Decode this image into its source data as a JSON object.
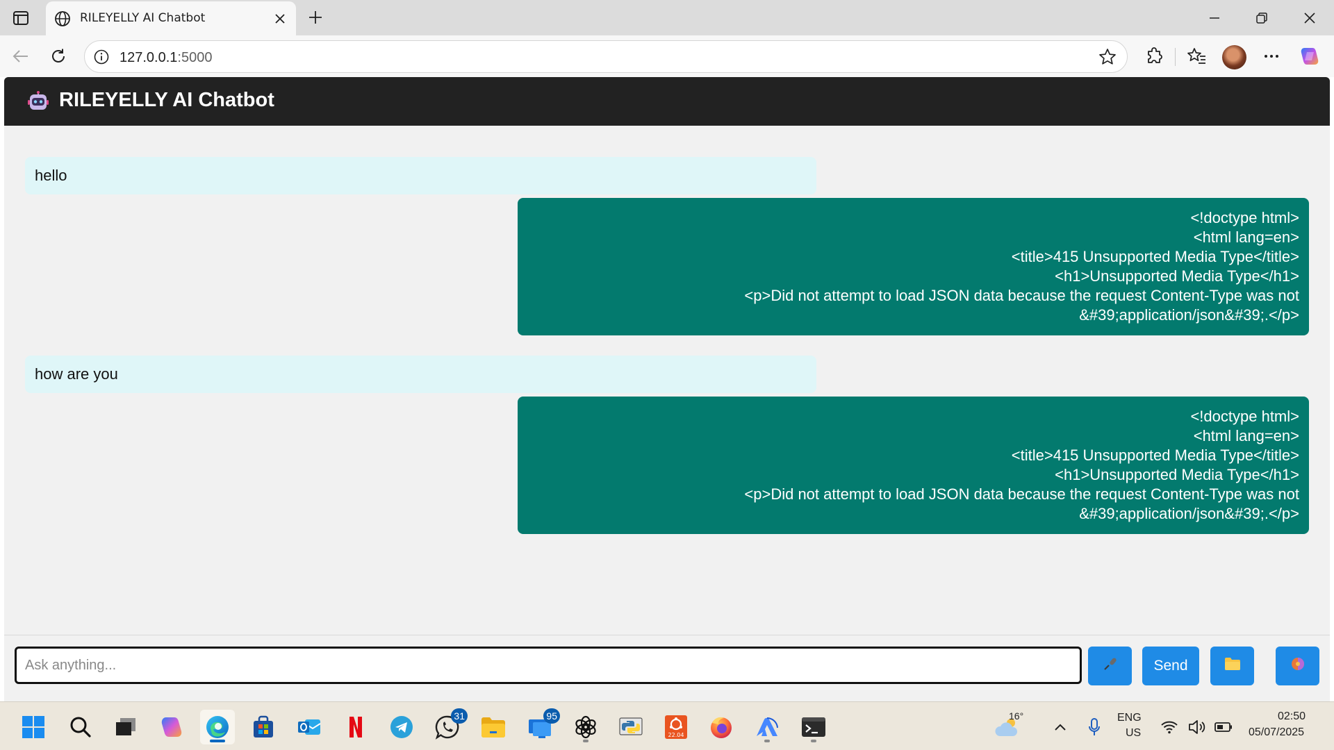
{
  "browser": {
    "tab_title": "RILEYELLY AI Chatbot",
    "url_host": "127.0.0.1",
    "url_port": ":5000"
  },
  "app": {
    "title": "RILEYELLY AI Chatbot"
  },
  "messages": [
    {
      "role": "user",
      "text": "hello"
    },
    {
      "role": "bot",
      "lines": [
        "<!doctype html>",
        "<html lang=en>",
        "<title>415 Unsupported Media Type</title>",
        "<h1>Unsupported Media Type</h1>",
        "<p>Did not attempt to load JSON data because the request Content-Type was not",
        "&#39;application/json&#39;.</p>"
      ]
    },
    {
      "role": "user",
      "text": "how are you"
    },
    {
      "role": "bot",
      "lines": [
        "<!doctype html>",
        "<html lang=en>",
        "<title>415 Unsupported Media Type</title>",
        "<h1>Unsupported Media Type</h1>",
        "<p>Did not attempt to load JSON data because the request Content-Type was not",
        "&#39;application/json&#39;.</p>"
      ]
    }
  ],
  "composer": {
    "placeholder": "Ask anything...",
    "send_label": "Send",
    "mic_icon": "microphone-icon",
    "folder_icon": "folder-icon",
    "extra_icon": "orb-icon"
  },
  "taskbar": {
    "whatsapp_badge": "31",
    "store_badge": "95",
    "ubuntu_label": "22.04",
    "weather_temp": "16°",
    "lang_line1": "ENG",
    "lang_line2": "US",
    "time": "02:50",
    "date": "05/07/2025"
  },
  "colors": {
    "header_bg": "#222222",
    "user_bubble": "#dff6f8",
    "bot_bubble": "#037a6e",
    "button_blue": "#1f8be6"
  }
}
